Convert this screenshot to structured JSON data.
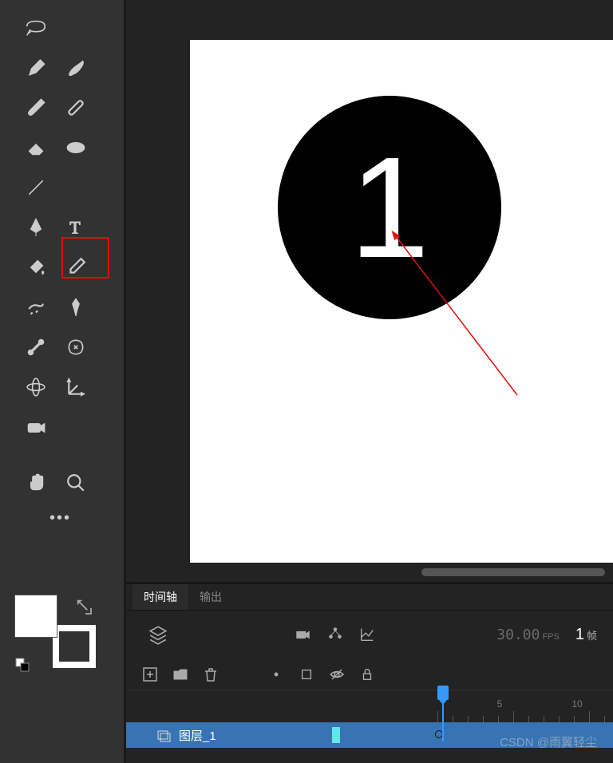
{
  "tools": {
    "row0": [
      "lasso-tool",
      ""
    ],
    "row1": [
      "pencil-tool",
      "fluid-brush-tool"
    ],
    "row2": [
      "brush-tool",
      "paintbrush-tool"
    ],
    "row3": [
      "eraser-tool",
      "ellipse-tool"
    ],
    "row4": [
      "line-tool",
      ""
    ],
    "row5": [
      "pen-tool",
      "text-tool"
    ],
    "row6": [
      "paint-bucket-tool",
      "eyedropper-tool"
    ],
    "row7": [
      "width-tool",
      "pin-tool"
    ],
    "row8": [
      "bone-tool",
      "bind-tool"
    ],
    "row9": [
      "asset-warp-tool",
      "3d-rotation-tool"
    ],
    "row10": [
      "camera-tool",
      ""
    ],
    "row11": [
      "hand-tool",
      "zoom-tool"
    ]
  },
  "canvas": {
    "circle_text": "1"
  },
  "timeline": {
    "tabs": {
      "timeline": "时间轴",
      "output": "输出"
    },
    "fps_value": "30.00",
    "fps_label": "FPS",
    "frame_value": "1",
    "frame_label": "帧",
    "ruler_marks": [
      "5",
      "10"
    ],
    "layer": {
      "name": "图层_1"
    }
  },
  "watermark": "CSDN @雨翼轻尘"
}
